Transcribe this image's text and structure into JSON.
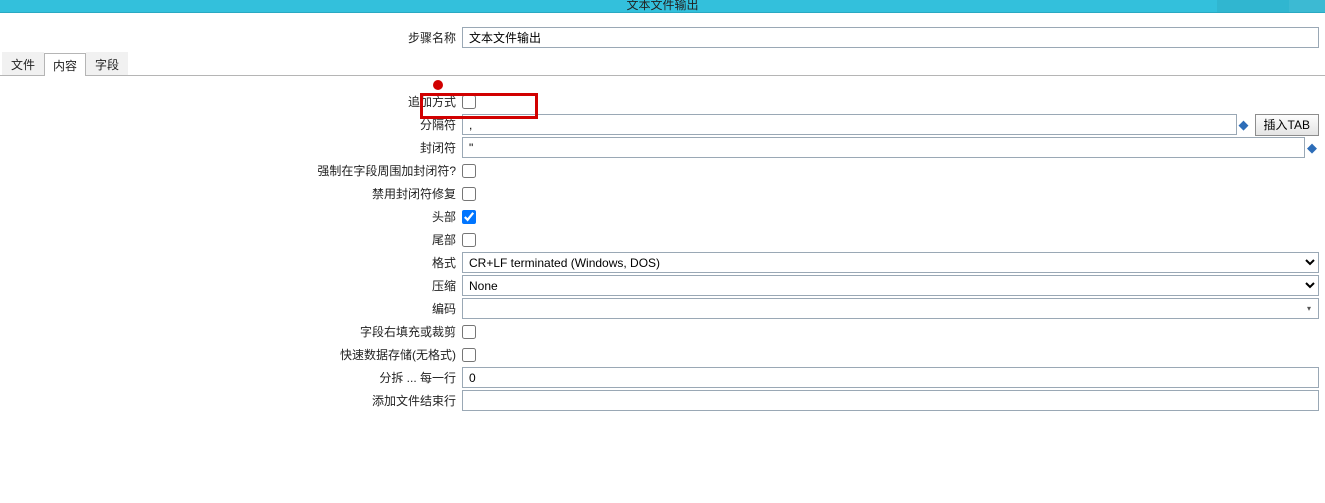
{
  "window": {
    "title": "文本文件输出"
  },
  "header": {
    "step_name_label": "步骤名称",
    "step_name_value": "文本文件输出"
  },
  "tabs": [
    "文件",
    "内容",
    "字段"
  ],
  "form": {
    "append": {
      "label": "追加方式",
      "checked": false
    },
    "separator": {
      "label": "分隔符",
      "value": ",",
      "button": "插入TAB"
    },
    "enclosure": {
      "label": "封闭符",
      "value": "\""
    },
    "force_enclosure": {
      "label": "强制在字段周围加封闭符?",
      "checked": false
    },
    "disable_enclosure_fix": {
      "label": "禁用封闭符修复",
      "checked": false
    },
    "header": {
      "label": "头部",
      "checked": true
    },
    "footer": {
      "label": "尾部",
      "checked": false
    },
    "format": {
      "label": "格式",
      "value": "CR+LF terminated (Windows, DOS)"
    },
    "compression": {
      "label": "压缩",
      "value": "None"
    },
    "encoding": {
      "label": "编码",
      "value": ""
    },
    "pad_or_trim": {
      "label": "字段右填充或裁剪",
      "checked": false
    },
    "fast_dump": {
      "label": "快速数据存储(无格式)",
      "checked": false
    },
    "split_every": {
      "label": "分拆 ... 每一行",
      "value": "0"
    },
    "add_ending_line": {
      "label": "添加文件结束行",
      "value": ""
    }
  }
}
